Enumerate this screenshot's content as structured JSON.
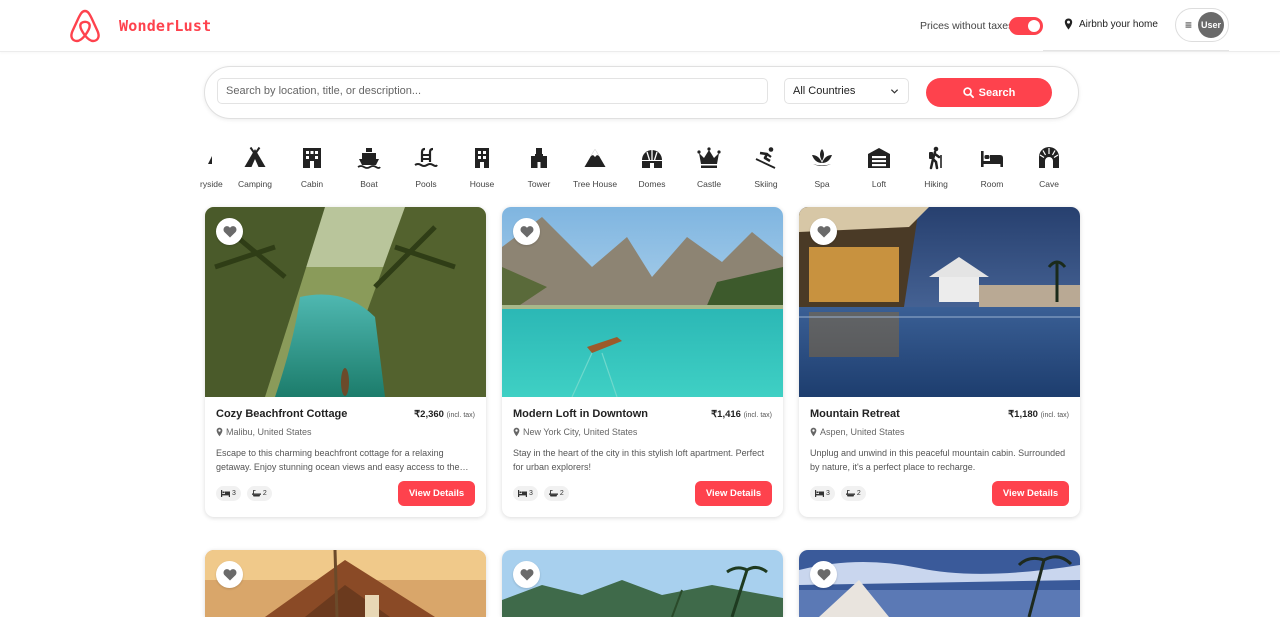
{
  "brand": {
    "name": "WonderLust",
    "color": "#fe424d",
    "logo_icon": "airbnb-logo-icon"
  },
  "header": {
    "tax_label": "Prices without taxes",
    "tax_toggle_on": true,
    "host_link": "Airbnb your home",
    "menu_icon": "≡",
    "user_label": "User"
  },
  "search": {
    "placeholder": "Search by location, title, or description...",
    "value": "",
    "country_selected": "All Countries",
    "button_label": "Search"
  },
  "filters": [
    {
      "label": "Countryside",
      "icon": "countryside-icon"
    },
    {
      "label": "Camping",
      "icon": "tent-icon"
    },
    {
      "label": "Cabin",
      "icon": "cabin-icon"
    },
    {
      "label": "Boat",
      "icon": "ship-icon"
    },
    {
      "label": "Pools",
      "icon": "pool-icon"
    },
    {
      "label": "House",
      "icon": "building-icon"
    },
    {
      "label": "Tower",
      "icon": "tower-icon"
    },
    {
      "label": "Tree House",
      "icon": "mountain-icon"
    },
    {
      "label": "Domes",
      "icon": "dome-icon"
    },
    {
      "label": "Castle",
      "icon": "crown-icon"
    },
    {
      "label": "Skiing",
      "icon": "skiing-icon"
    },
    {
      "label": "Spa",
      "icon": "spa-icon"
    },
    {
      "label": "Loft",
      "icon": "warehouse-icon"
    },
    {
      "label": "Hiking",
      "icon": "hiking-icon"
    },
    {
      "label": "Room",
      "icon": "bed-icon"
    },
    {
      "label": "Cave",
      "icon": "archway-icon"
    }
  ],
  "listings": [
    {
      "title": "Cozy Beachfront Cottage",
      "price": "₹2,360",
      "tax_note": "(incl. tax)",
      "location": "Malibu, United States",
      "description": "Escape to this charming beachfront cottage for a relaxing getaway. Enjoy stunning ocean views and easy access to the beach.",
      "beds": "3",
      "baths": "2",
      "button": "View Details"
    },
    {
      "title": "Modern Loft in Downtown",
      "price": "₹1,416",
      "tax_note": "(incl. tax)",
      "location": "New York City, United States",
      "description": "Stay in the heart of the city in this stylish loft apartment. Perfect for urban explorers!",
      "beds": "3",
      "baths": "2",
      "button": "View Details"
    },
    {
      "title": "Mountain Retreat",
      "price": "₹1,180",
      "tax_note": "(incl. tax)",
      "location": "Aspen, United States",
      "description": "Unplug and unwind in this peaceful mountain cabin. Surrounded by nature, it's a perfect place to recharge.",
      "beds": "3",
      "baths": "2",
      "button": "View Details"
    }
  ]
}
